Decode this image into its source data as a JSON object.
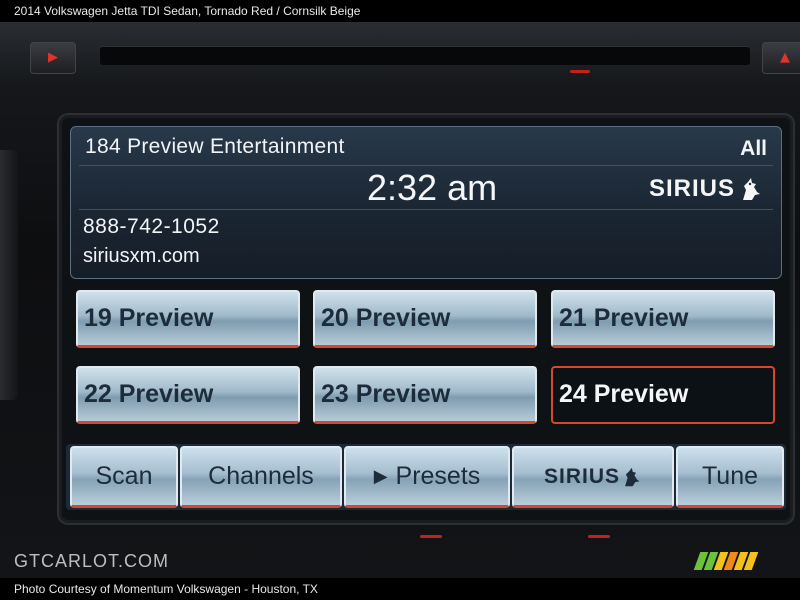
{
  "caption": {
    "top": "2014 Volkswagen Jetta TDI Sedan,  Tornado Red / Cornsilk Beige",
    "bottom": "Photo Courtesy of Momentum Volkswagen - Houston, TX"
  },
  "watermark": "GTCARLOT.COM",
  "display": {
    "channel_name": "184 Preview Entertainment",
    "category": "All",
    "time": "2:32 am",
    "logo": "SIRIUS",
    "phone": "888-742-1052",
    "website": "siriusxm.com"
  },
  "presets": [
    {
      "label": "19 Preview",
      "active": false
    },
    {
      "label": "20 Preview",
      "active": false
    },
    {
      "label": "21 Preview",
      "active": false
    },
    {
      "label": "22 Preview",
      "active": false
    },
    {
      "label": "23 Preview",
      "active": false
    },
    {
      "label": "24 Preview",
      "active": true
    }
  ],
  "bottom_bar": {
    "scan": "Scan",
    "channels": "Channels",
    "presets": "Presets",
    "sirius": "SIRIUS",
    "tune": "Tune"
  },
  "colors": {
    "accent_red": "#d8462d",
    "button_blue": "#a4bdce",
    "panel_blue": "#1b2633",
    "stripe_green": "#6cc23a",
    "stripe_yellow": "#f3c11e",
    "stripe_orange": "#f08a1c"
  }
}
